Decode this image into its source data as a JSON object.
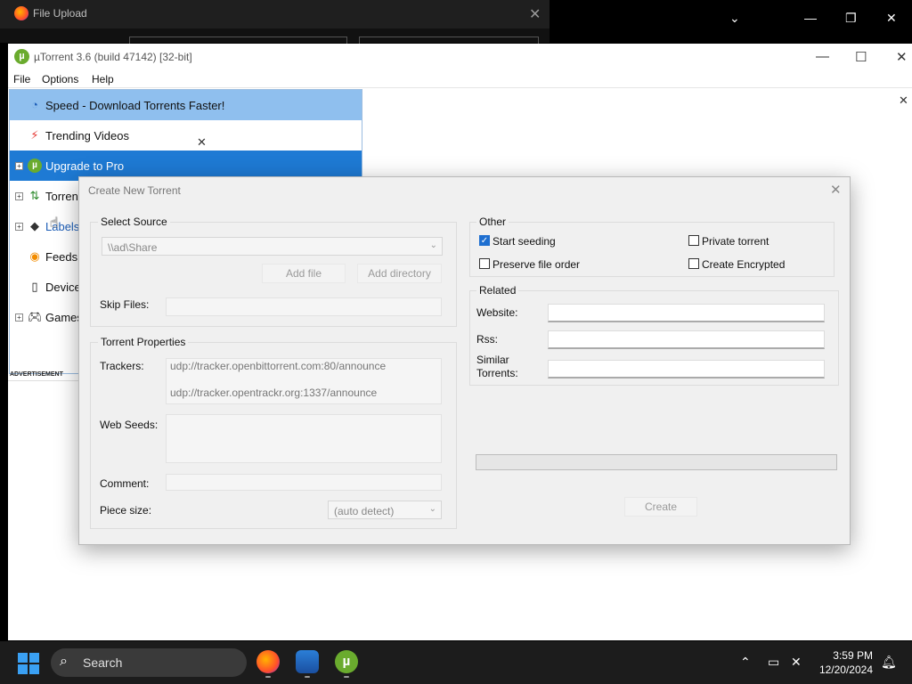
{
  "bg_window": {
    "title": "File Upload"
  },
  "utorrent": {
    "title": "µTorrent 3.6  (build 47142) [32-bit]",
    "menu": [
      "File",
      "Options",
      "Help"
    ]
  },
  "sidebar": {
    "items": [
      {
        "label": "Speed - Download Torrents Faster!",
        "icon": "speed-icon"
      },
      {
        "label": "Trending Videos",
        "icon": "bolt-icon"
      },
      {
        "label": "Upgrade to Pro",
        "icon": "utorrent-logo-icon"
      },
      {
        "label": "Torrents",
        "icon": "torrent-arrows-icon"
      },
      {
        "label": "Labels",
        "icon": "tag-icon"
      },
      {
        "label": "Feeds",
        "icon": "rss-icon"
      },
      {
        "label": "Devices",
        "icon": "device-icon"
      },
      {
        "label": "Games",
        "icon": "gamepad-icon"
      }
    ],
    "advertisement": "ADVERTISEMENT"
  },
  "dialog": {
    "title": "Create New Torrent",
    "select_source": {
      "legend": "Select Source",
      "path": "\\\\ad\\Share",
      "add_file": "Add file",
      "add_directory": "Add directory",
      "skip_files_label": "Skip Files:"
    },
    "torrent_properties": {
      "legend": "Torrent Properties",
      "trackers_label": "Trackers:",
      "trackers": [
        "udp://tracker.openbittorrent.com:80/announce",
        "udp://tracker.opentrackr.org:1337/announce"
      ],
      "web_seeds_label": "Web Seeds:",
      "comment_label": "Comment:",
      "piece_size_label": "Piece size:",
      "piece_size_value": "(auto detect)"
    },
    "other": {
      "legend": "Other",
      "start_seeding": "Start seeding",
      "start_seeding_checked": true,
      "private_torrent": "Private torrent",
      "preserve_file_order": "Preserve file order",
      "create_encrypted": "Create Encrypted"
    },
    "related": {
      "legend": "Related",
      "website_label": "Website:",
      "rss_label": "Rss:",
      "similar_label_line1": "Similar",
      "similar_label_line2": "Torrents:"
    },
    "create_button": "Create"
  },
  "taskbar": {
    "search_placeholder": "Search",
    "time": "3:59 PM",
    "date": "12/20/2024"
  }
}
